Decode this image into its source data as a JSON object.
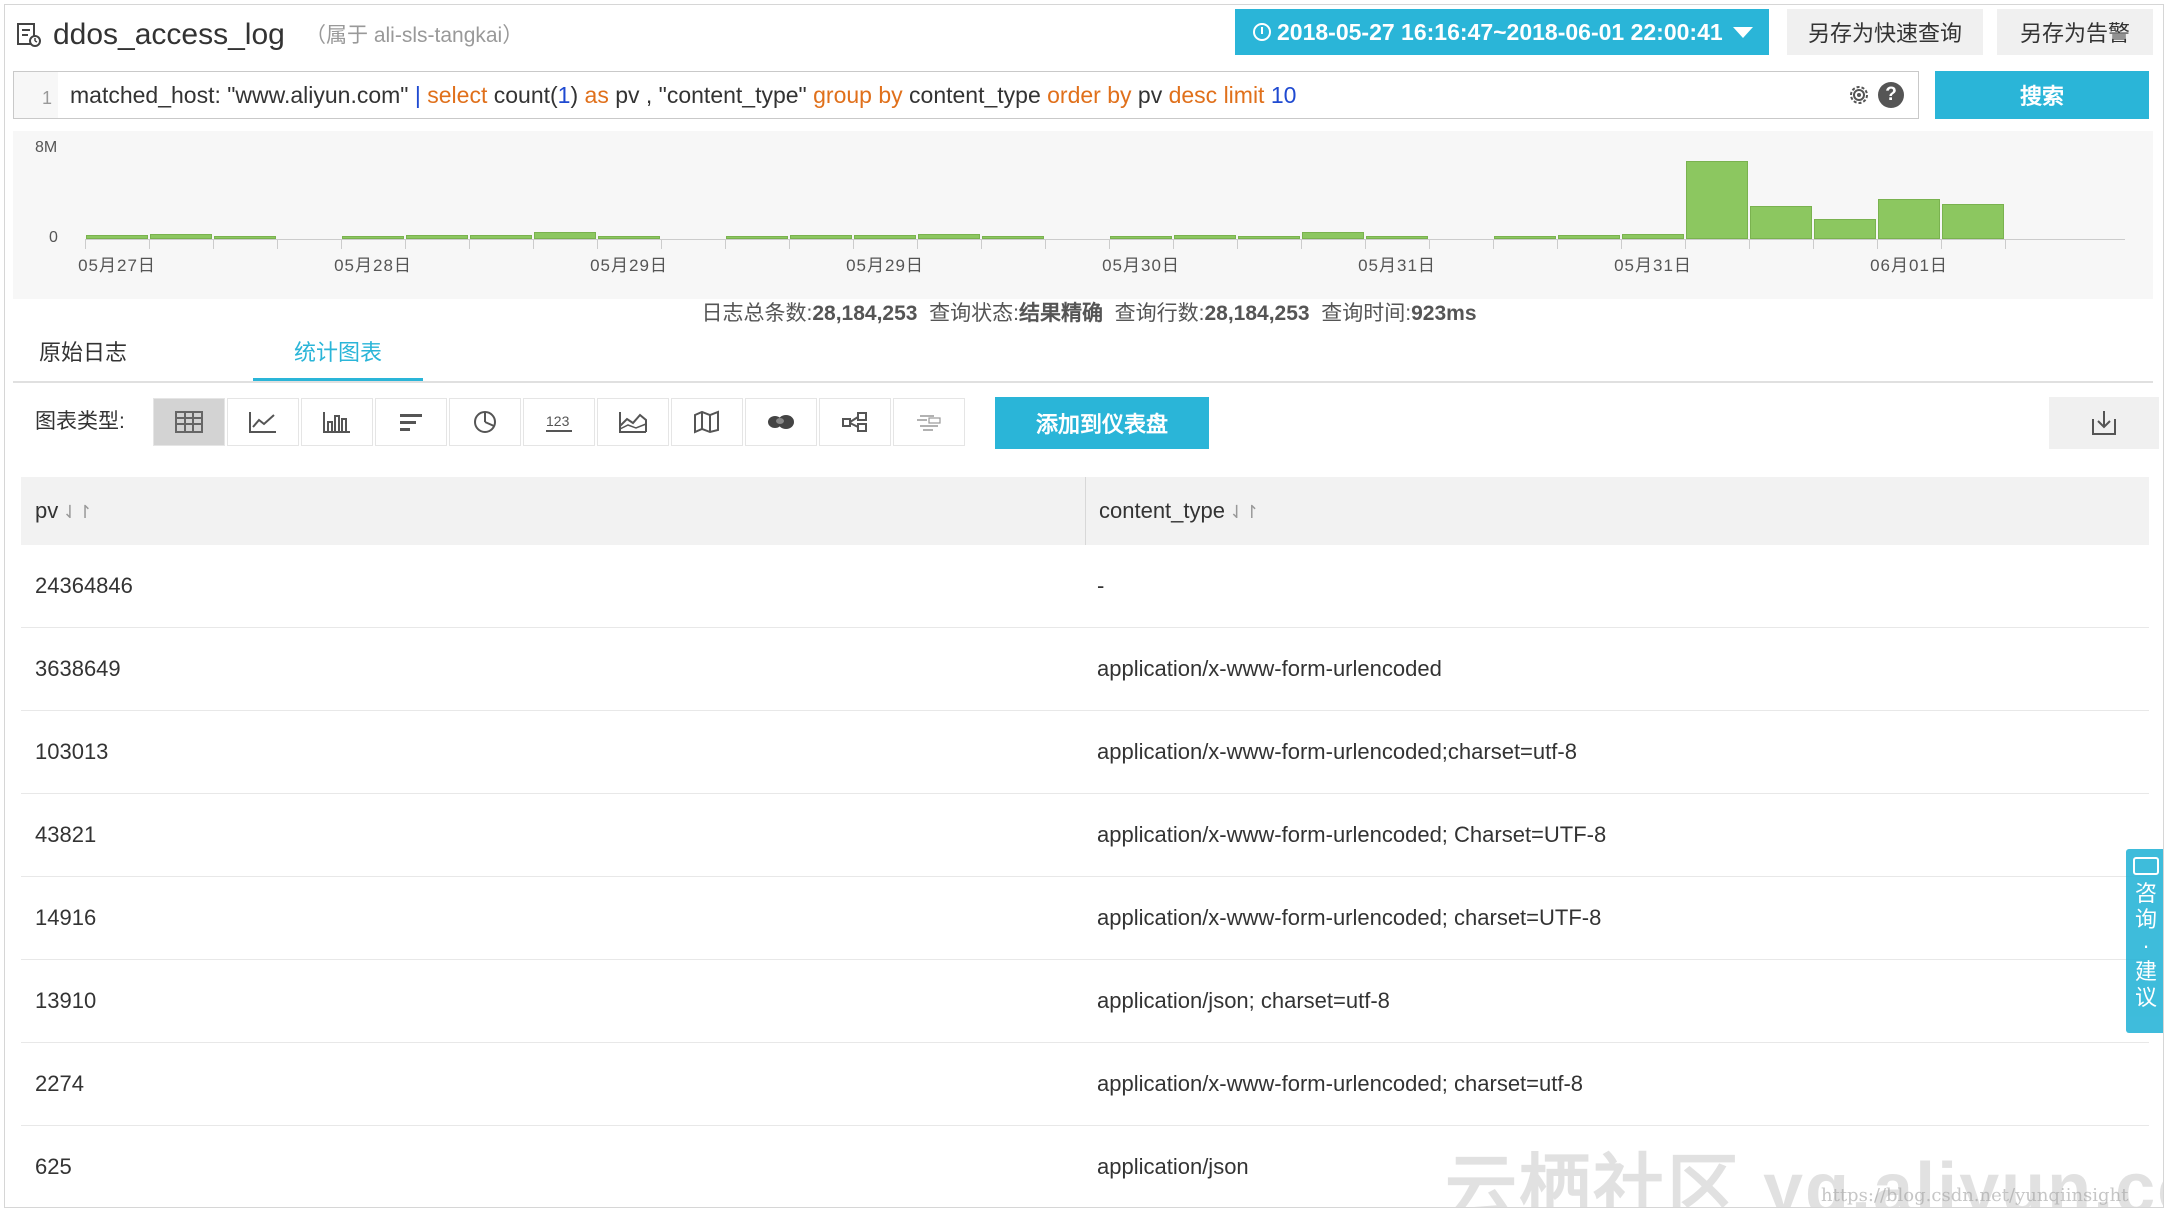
{
  "header": {
    "logstore": "ddos_access_log",
    "project": "（属于 ali-sls-tangkai）",
    "time_range": "2018-05-27 16:16:47~2018-06-01 22:00:41",
    "save_quick_query": "另存为快速查询",
    "save_alert": "另存为告警"
  },
  "query": {
    "line_no": "1",
    "p1": "matched_host: \"www.aliyun.com\" ",
    "pipe": "| ",
    "kw_select": "select",
    "p2": "  count(",
    "num1": "1",
    "p3": ")",
    "kw_as": " as",
    "p4": " pv , \"content_type\" ",
    "kw_groupby": "group by",
    "p5": " content_type ",
    "kw_orderby": "order by",
    "p6": " pv  ",
    "kw_desc": "desc limit",
    "num10": " 10",
    "search_label": "搜索",
    "help": "?"
  },
  "histogram": {
    "y_max_label": "8M",
    "y_zero_label": "0",
    "x_labels": [
      "05月27日",
      "05月28日",
      "05月29日",
      "05月29日",
      "05月30日",
      "05月31日",
      "05月31日",
      "06月01日"
    ],
    "bar_color": "#8cc760",
    "bars": [
      0.04,
      0.05,
      0.02,
      0,
      0.03,
      0.04,
      0.04,
      0.07,
      0.02,
      0,
      0.03,
      0.04,
      0.04,
      0.05,
      0.02,
      0,
      0.02,
      0.04,
      0.03,
      0.07,
      0.02,
      0,
      0.02,
      0.04,
      0.05,
      0.81,
      0.34,
      0.21,
      0.42,
      0.36
    ]
  },
  "stats": {
    "total_label": "日志总条数:",
    "total_value": "28,184,253",
    "status_label": "查询状态:",
    "status_value": "结果精确",
    "rows_label": "查询行数:",
    "rows_value": "28,184,253",
    "time_label": "查询时间:",
    "time_value": "923ms"
  },
  "tabs": {
    "raw": "原始日志",
    "stats": "统计图表"
  },
  "toolbar": {
    "label": "图表类型:",
    "add_dashboard": "添加到仪表盘",
    "icons": [
      "table-icon",
      "line-chart-icon",
      "bar-chart-icon",
      "horizontal-bar-icon",
      "pie-chart-icon",
      "number-icon",
      "area-chart-icon",
      "map-icon",
      "heatmap-icon",
      "flow-graph-icon",
      "word-cloud-icon"
    ]
  },
  "table": {
    "columns": [
      "pv",
      "content_type"
    ],
    "rows": [
      [
        "24364846",
        "-"
      ],
      [
        "3638649",
        "application/x-www-form-urlencoded"
      ],
      [
        "103013",
        "application/x-www-form-urlencoded;charset=utf-8"
      ],
      [
        "43821",
        "application/x-www-form-urlencoded; Charset=UTF-8"
      ],
      [
        "14916",
        "application/x-www-form-urlencoded; charset=UTF-8"
      ],
      [
        "13910",
        "application/json; charset=utf-8"
      ],
      [
        "2274",
        "application/x-www-form-urlencoded; charset=utf-8"
      ],
      [
        "625",
        "application/json"
      ]
    ]
  },
  "consult": [
    "咨",
    "询",
    "·",
    "建",
    "议"
  ],
  "watermark": "云栖社区 yq.aliyun.com",
  "watermark_url": "https://blog.csdn.net/yunqiinsight",
  "colors": {
    "accent": "#2ab5d8",
    "keyword": "#e0701b",
    "number": "#1f4ad1"
  }
}
